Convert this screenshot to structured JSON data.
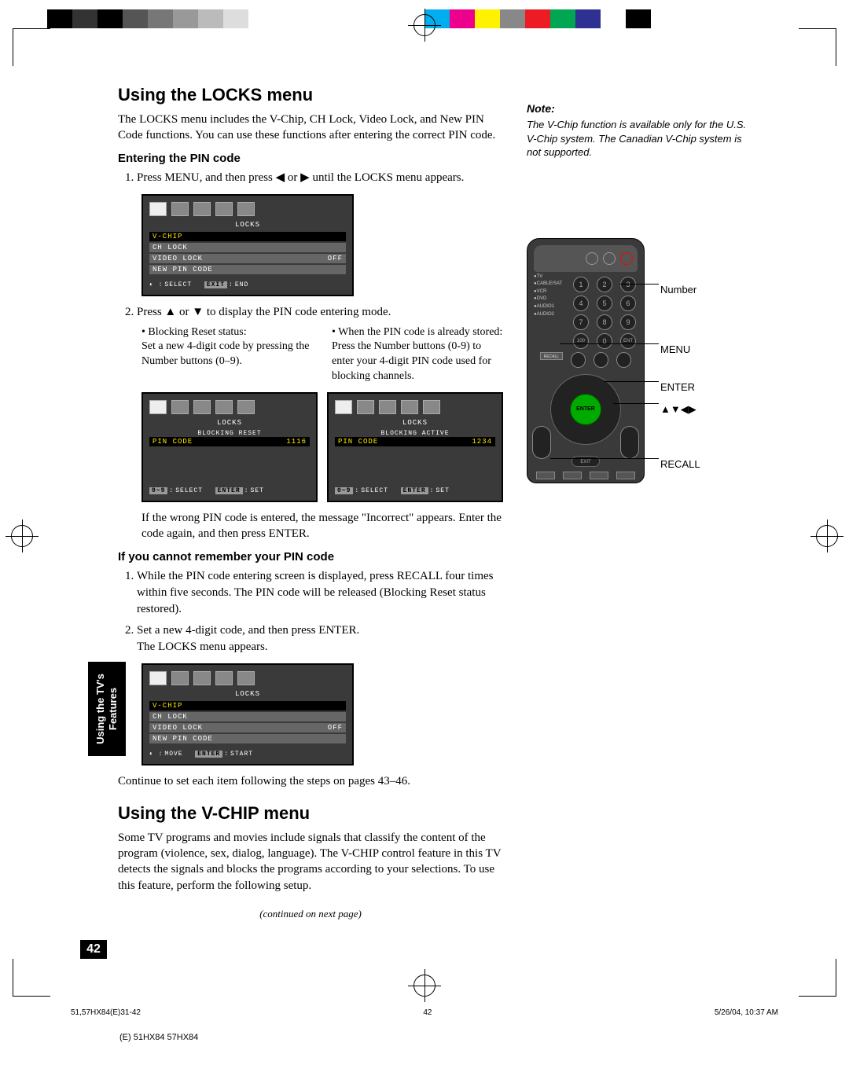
{
  "page_number": "42",
  "side_tab": "Using the TV's\nFeatures",
  "h1_locks": "Using the LOCKS menu",
  "p_locks_intro": "The LOCKS menu includes the V-Chip, CH Lock, Video Lock, and New PIN Code functions. You can use these functions after entering the correct PIN code.",
  "h2_enter_pin": "Entering the PIN code",
  "step1": "Press MENU, and then press ◀ or ▶ until the LOCKS menu appears.",
  "step2": "Press ▲ or ▼ to display the PIN code entering mode.",
  "col_left": "Blocking Reset status:\nSet a new 4-digit code by pressing the Number buttons (0–9).",
  "col_right": "When the PIN code is already stored:\nPress the Number buttons (0-9) to enter your 4-digit PIN code used for blocking channels.",
  "incorrect_para": "If the wrong PIN code is entered, the message \"Incorrect\" appears. Enter the code again, and then press ENTER.",
  "h2_forgot": "If you cannot remember your PIN code",
  "forgot_step1": "While the PIN code entering screen is displayed, press RECALL four times within five seconds. The PIN code will be released (Blocking Reset status restored).",
  "forgot_step2": "Set a new 4-digit code, and then press ENTER.\nThe LOCKS menu appears.",
  "continue_para": "Continue to set each item following the steps on pages 43–46.",
  "h1_vchip": "Using the V-CHIP menu",
  "p_vchip": "Some TV programs and movies include signals that classify the content of the program (violence, sex, dialog, language). The V-CHIP control feature in this TV detects the signals and blocks the programs according to your selections. To use this feature, perform the following setup.",
  "continued": "(continued on next page)",
  "note_h": "Note:",
  "note_b": "The V-Chip function is available only for the U.S. V-Chip system. The Canadian V-Chip system is not supported.",
  "osd": {
    "title": "LOCKS",
    "items": [
      "V-CHIP",
      "CH LOCK",
      "VIDEO LOCK",
      "NEW PIN CODE"
    ],
    "off": "OFF",
    "select": "SELECT",
    "exit": "EXIT",
    "end": "END",
    "move": "MOVE",
    "enter": "ENTER",
    "start": "START",
    "set": "SET",
    "zero9": "0~9",
    "reset_title": "BLOCKING RESET",
    "active_title": "BLOCKING ACTIVE",
    "pin_code": "PIN CODE",
    "pin1": "1116",
    "pin2": "1234"
  },
  "remote_labels": {
    "number": "Number",
    "menu": "MENU",
    "enter": "ENTER",
    "arrows": "▲▼◀▶",
    "recall": "RECALL",
    "device_list": "●TV\n●CABLE/SAT\n●VCR\n●DVD\n●AUDIO1\n●AUDIO2",
    "enter_btn": "ENTER",
    "exit": "EXIT"
  },
  "footer": {
    "left": "51,57HX84(E)31-42",
    "mid": "42",
    "right": "5/26/04, 10:37 AM"
  },
  "model": "(E) 51HX84 57HX84",
  "color_bar": [
    "#000000",
    "#333333",
    "#000000",
    "#555555",
    "#777777",
    "#999999",
    "#bbbbbb",
    "#dddddd",
    "#ffffff",
    "#ffffff",
    "#ffffff",
    "#ffffff",
    "#ffffff",
    "#ffffff",
    "#ffffff",
    "#00aeef",
    "#ec008c",
    "#fff200",
    "#888888",
    "#ed1c24",
    "#00a651",
    "#2e3192",
    "#ffffff",
    "#000000",
    "#ffffff"
  ]
}
